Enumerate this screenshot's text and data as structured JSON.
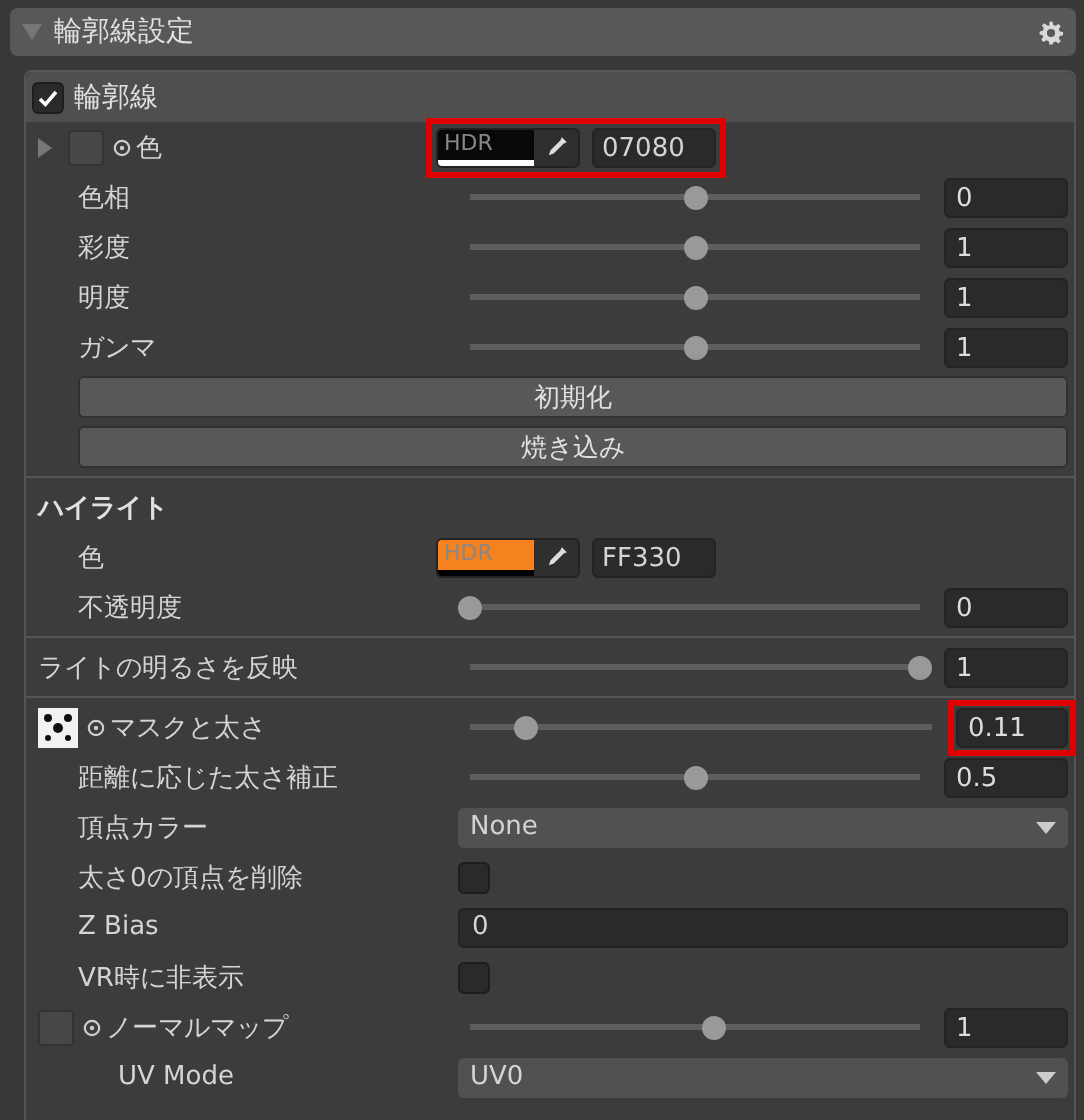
{
  "panel": {
    "title": "輪郭線設定",
    "expanded": true
  },
  "section": {
    "title": "輪郭線",
    "checked": true
  },
  "groups": [
    [
      {
        "kind": "color",
        "label": "色",
        "expandable": true,
        "hdr": "HDR",
        "hex": "07080",
        "color": "#070808",
        "level": 1,
        "highlighted": true
      },
      {
        "kind": "slider",
        "label": "色相",
        "level": 0.5,
        "value": "0"
      },
      {
        "kind": "slider",
        "label": "彩度",
        "level": 0.5,
        "value": "1"
      },
      {
        "kind": "slider",
        "label": "明度",
        "level": 0.5,
        "value": "1"
      },
      {
        "kind": "slider",
        "label": "ガンマ",
        "level": 0.5,
        "value": "1"
      },
      {
        "kind": "button",
        "label": "初期化"
      },
      {
        "kind": "button",
        "label": "焼き込み"
      }
    ],
    [
      {
        "kind": "heading",
        "label": "ハイライト"
      },
      {
        "kind": "color",
        "label": "色",
        "expandable": false,
        "hdr": "HDR",
        "hex": "FF330",
        "color": "#f5821f",
        "level": 0,
        "highlighted": false
      },
      {
        "kind": "slider",
        "label": "不透明度",
        "level": 0,
        "value": "0"
      }
    ],
    [
      {
        "kind": "wideslider",
        "label": "ライトの明るさを反映",
        "level": 1,
        "value": "1"
      }
    ],
    [
      {
        "kind": "texture",
        "label": "マスクと太さ",
        "texture_set": true,
        "level": 0.12,
        "value": "0.11",
        "highlighted": true
      },
      {
        "kind": "slider",
        "label": "距離に応じた太さ補正",
        "level": 0.5,
        "value": "0.5"
      },
      {
        "kind": "dropdown",
        "label": "頂点カラー",
        "value": "None"
      },
      {
        "kind": "checkbox",
        "label": "太さ0の頂点を削除",
        "checked": false
      },
      {
        "kind": "number",
        "label": "Z Bias",
        "value": "0"
      },
      {
        "kind": "checkbox",
        "label": "VR時に非表示",
        "checked": false
      },
      {
        "kind": "texture",
        "label": "ノーマルマップ",
        "texture_set": false,
        "level": 0.54,
        "value": "1",
        "highlighted": false
      },
      {
        "kind": "subdropdown",
        "label": "UV Mode",
        "value": "UV0"
      }
    ]
  ]
}
